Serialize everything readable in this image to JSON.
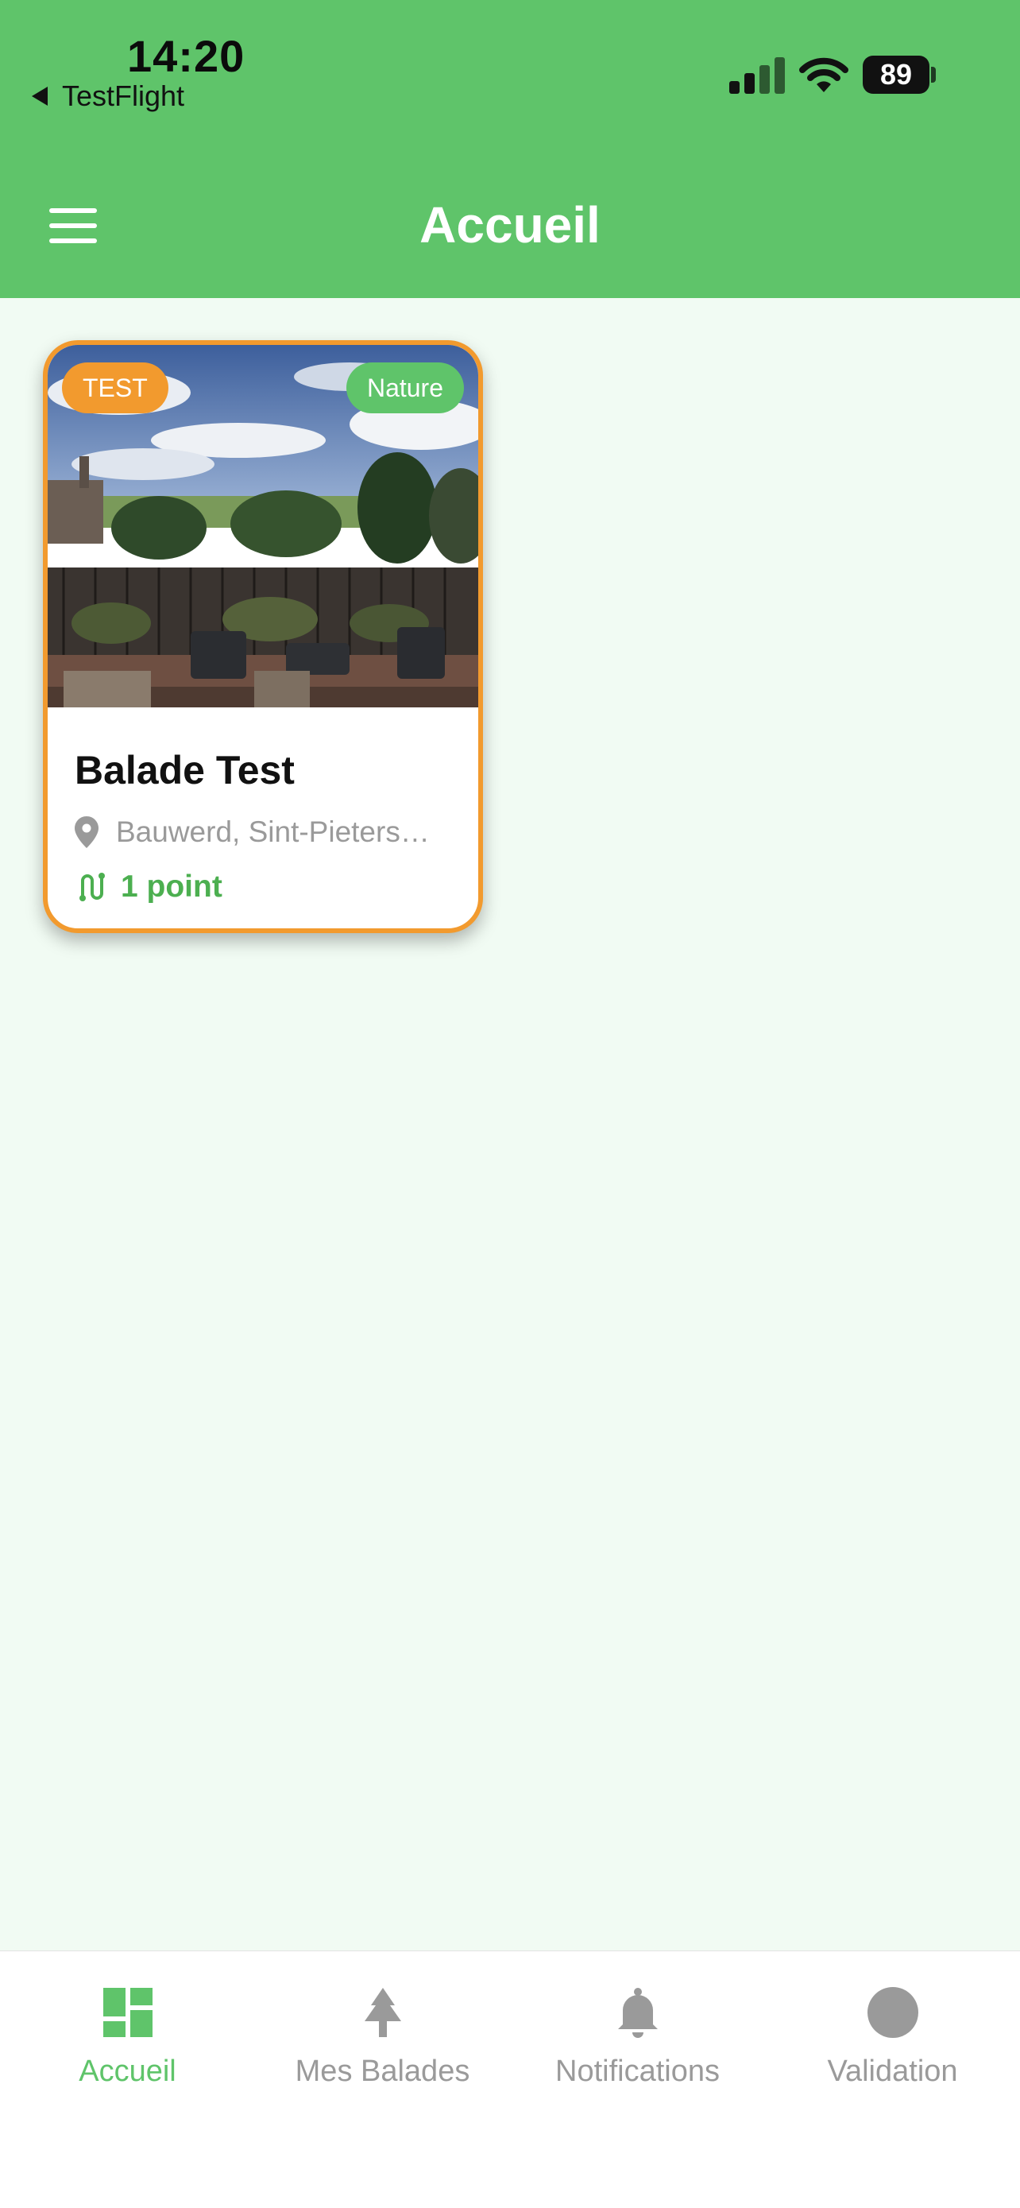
{
  "status_bar": {
    "time": "14:20",
    "back_app": "TestFlight",
    "battery": "89"
  },
  "header": {
    "title": "Accueil",
    "menu_icon": "hamburger-menu-icon"
  },
  "walks": [
    {
      "title": "Balade Test",
      "badge": "TEST",
      "category": "Nature",
      "location": "Bauwerd, Sint-Pieters…",
      "points": "1 point",
      "image": "garden-terrace-photo",
      "badge_color": "#f29a2e",
      "category_color": "#5fc46a"
    }
  ],
  "tabbar": {
    "items": [
      {
        "label": "Accueil",
        "icon": "dashboard-icon",
        "active": true
      },
      {
        "label": "Mes Balades",
        "icon": "tree-icon",
        "active": false
      },
      {
        "label": "Notifications",
        "icon": "bell-icon",
        "active": false
      },
      {
        "label": "Validation",
        "icon": "circle-icon",
        "active": false
      }
    ]
  },
  "colors": {
    "primary": "#5fc46a",
    "accent": "#f29a2e",
    "background": "#f1fbf3",
    "inactive": "#9a9a9a"
  }
}
